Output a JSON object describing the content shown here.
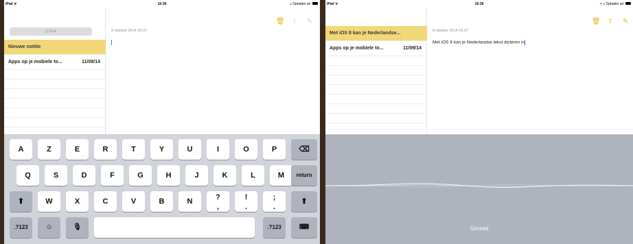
{
  "left_screen": {
    "status": {
      "carrier": "iPad ᯤ",
      "time": "16:30",
      "battery_text": "⁎ Opladen uit"
    },
    "search": {
      "placeholder": "Q  Zoek"
    },
    "notes": [
      {
        "title": "Nieuwe notitie",
        "date": ""
      },
      {
        "title": "Apps op je mobiele to...",
        "date": "11/09/14"
      }
    ],
    "editor": {
      "date": "8 oktober 2014 16:37",
      "text": ""
    },
    "keyboard": {
      "row1": [
        "A",
        "Z",
        "E",
        "R",
        "T",
        "Y",
        "U",
        "I",
        "O",
        "P"
      ],
      "row2": [
        "Q",
        "S",
        "D",
        "F",
        "G",
        "H",
        "J",
        "K",
        "L",
        "M"
      ],
      "row3": [
        "W",
        "X",
        "C",
        "V",
        "B",
        "N",
        "?",
        "!",
        ";"
      ],
      "row3_sub": [
        ",",
        ".",
        "."
      ],
      "return_label": "return",
      "numbers_label": ".?123",
      "emoji_icon": "emoji-icon",
      "mic_icon": "microphone-icon",
      "hide_keyboard_icon": "keyboard-hide-icon",
      "shift_icon": "shift-icon",
      "backspace_icon": "backspace-icon"
    }
  },
  "right_screen": {
    "status": {
      "carrier": "iPad ᯤ",
      "time": "16:36",
      "battery_text": "➚ ⁎ Opladen uit"
    },
    "notes": [
      {
        "title": "Met iOS 8 kan je Nederlandse...",
        "date": ""
      },
      {
        "title": "Apps op je mobiele to...",
        "date": "11/09/14"
      }
    ],
    "editor": {
      "date": "8 oktober 2014 16:27",
      "text": "Met iOS 8 kan je Nederlandse tekst dicteren in"
    },
    "dictation": {
      "done_label": "Gereed"
    }
  },
  "colors": {
    "accent": "#f2b418",
    "selected_note": "#f0d878",
    "keyboard_bg": "#d1d4da",
    "dictation_bg": "#aeb3bd"
  }
}
